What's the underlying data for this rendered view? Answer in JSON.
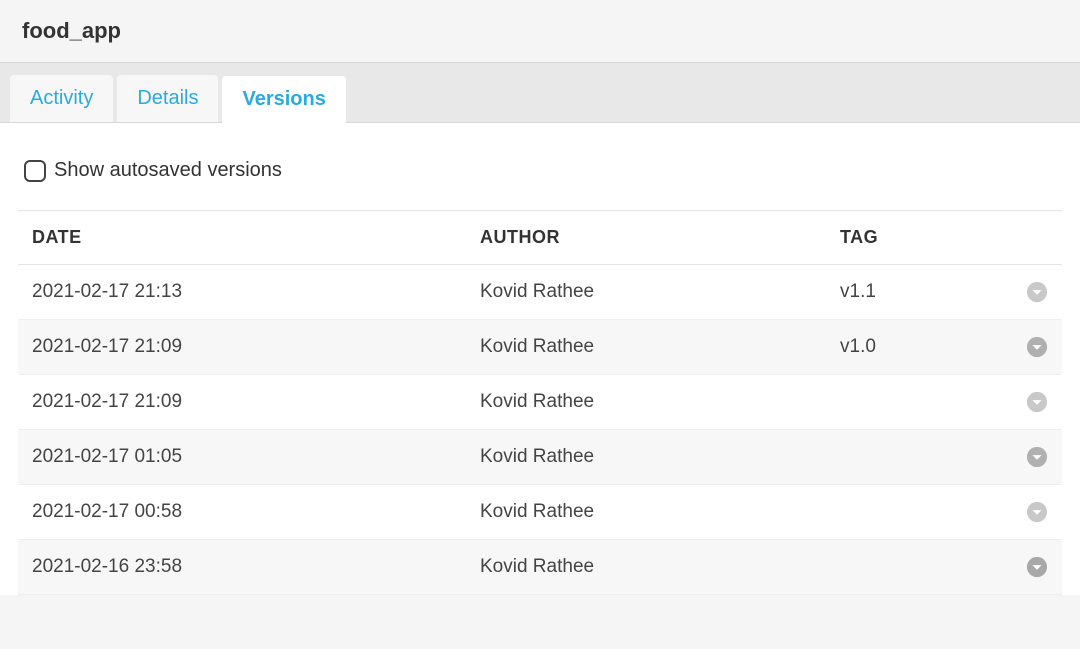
{
  "header": {
    "title": "food_app"
  },
  "tabs": [
    {
      "label": "Activity",
      "active": false
    },
    {
      "label": "Details",
      "active": false
    },
    {
      "label": "Versions",
      "active": true
    }
  ],
  "options": {
    "show_autosaved_label": "Show autosaved versions",
    "show_autosaved_checked": false
  },
  "table": {
    "columns": {
      "date": "DATE",
      "author": "AUTHOR",
      "tag": "TAG"
    },
    "rows": [
      {
        "date": "2021-02-17 21:13",
        "author": "Kovid Rathee",
        "tag": "v1.1"
      },
      {
        "date": "2021-02-17 21:09",
        "author": "Kovid Rathee",
        "tag": "v1.0"
      },
      {
        "date": "2021-02-17 21:09",
        "author": "Kovid Rathee",
        "tag": ""
      },
      {
        "date": "2021-02-17 01:05",
        "author": "Kovid Rathee",
        "tag": ""
      },
      {
        "date": "2021-02-17 00:58",
        "author": "Kovid Rathee",
        "tag": ""
      },
      {
        "date": "2021-02-16 23:58",
        "author": "Kovid Rathee",
        "tag": ""
      }
    ]
  }
}
